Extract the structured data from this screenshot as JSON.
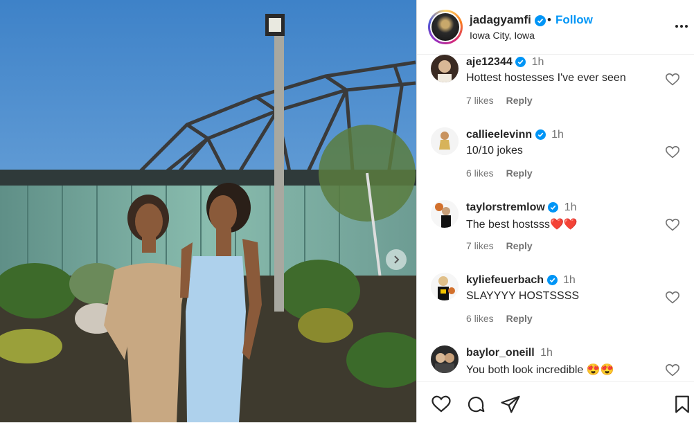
{
  "post": {
    "username": "jadagyamfi",
    "follow_label": "Follow",
    "separator": "•",
    "location": "Iowa City, Iowa"
  },
  "comments": [
    {
      "username": "aje12344",
      "time": "1h",
      "text": "Hottest hostesses I've ever seen",
      "likes": "7 likes",
      "reply": "Reply",
      "verified": true
    },
    {
      "username": "callieelevinn",
      "time": "1h",
      "text": "10/10 jokes",
      "likes": "6 likes",
      "reply": "Reply",
      "verified": true
    },
    {
      "username": "taylorstremlow",
      "time": "1h",
      "text": "The best hostsss❤️❤️",
      "likes": "7 likes",
      "reply": "Reply",
      "verified": true
    },
    {
      "username": "kyliefeuerbach",
      "time": "1h",
      "text": "SLAYYYY HOSTSSSS",
      "likes": "6 likes",
      "reply": "Reply",
      "verified": true
    },
    {
      "username": "baylor_oneill",
      "time": "1h",
      "text": "You both look incredible 😍😍",
      "likes": "",
      "reply": "",
      "verified": false
    }
  ],
  "colors": {
    "accent": "#0095f6",
    "verified": "#0095f6",
    "text": "#262626",
    "muted": "#737373"
  },
  "icons": [
    "verified-badge-icon",
    "more-options-icon",
    "heart-icon",
    "comment-icon",
    "share-icon",
    "bookmark-icon",
    "chevron-right-icon"
  ]
}
